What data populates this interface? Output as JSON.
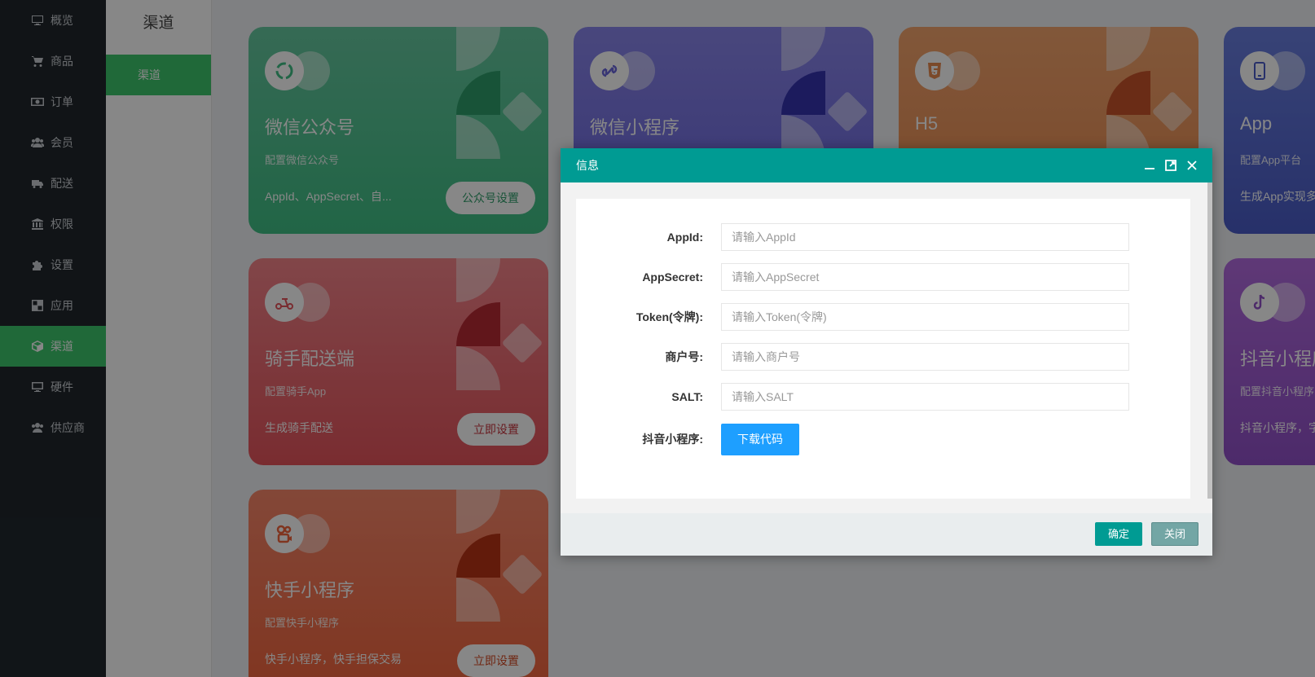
{
  "sidebar": {
    "items": [
      {
        "label": "概览",
        "icon": "monitor-icon"
      },
      {
        "label": "商品",
        "icon": "cart-icon"
      },
      {
        "label": "订单",
        "icon": "money-icon"
      },
      {
        "label": "会员",
        "icon": "users-icon"
      },
      {
        "label": "配送",
        "icon": "truck-icon"
      },
      {
        "label": "权限",
        "icon": "bank-icon"
      },
      {
        "label": "设置",
        "icon": "puzzle-icon"
      },
      {
        "label": "应用",
        "icon": "apps-icon"
      },
      {
        "label": "渠道",
        "icon": "cube-icon",
        "active": true
      },
      {
        "label": "硬件",
        "icon": "desktop-icon"
      },
      {
        "label": "供应商",
        "icon": "supplier-icon"
      }
    ]
  },
  "subbar": {
    "title": "渠道",
    "items": [
      {
        "label": "渠道",
        "active": true
      }
    ]
  },
  "cards": [
    {
      "title": "微信公众号",
      "desc": "配置微信公众号",
      "info": "AppId、AppSecret、自...",
      "button": "公众号设置",
      "icon": "wechat-icon",
      "color": "#3fbf85"
    },
    {
      "title": "微信小程序",
      "desc": "",
      "info": "",
      "button": "",
      "icon": "miniprogram-icon",
      "color": "#6a66dc"
    },
    {
      "title": "H5",
      "desc": "",
      "info": "",
      "button": "",
      "icon": "html5-icon",
      "color": "#e98a4f"
    },
    {
      "title": "App",
      "desc": "配置App平台",
      "info": "生成App实现多",
      "button": "",
      "icon": "phone-icon",
      "color": "#4a5cc8"
    },
    {
      "title": "骑手配送端",
      "desc": "配置骑手App",
      "info": "生成骑手配送",
      "button": "立即设置",
      "icon": "scooter-icon",
      "color": "#e5545c"
    },
    {
      "title": "抖音小程序",
      "desc": "配置抖音小程序",
      "info": "抖音小程序，字",
      "button": "",
      "icon": "tiktok-icon",
      "color": "#9150c9"
    },
    {
      "title": "快手小程序",
      "desc": "配置快手小程序",
      "info": "快手小程序，快手担保交易",
      "button": "立即设置",
      "icon": "kuaishou-icon",
      "color": "#f2643c"
    }
  ],
  "dialog": {
    "title": "信息",
    "fields": [
      {
        "label": "AppId:",
        "placeholder": "请输入AppId",
        "value": ""
      },
      {
        "label": "AppSecret:",
        "placeholder": "请输入AppSecret",
        "value": ""
      },
      {
        "label": "Token(令牌):",
        "placeholder": "请输入Token(令牌)",
        "value": ""
      },
      {
        "label": "商户号:",
        "placeholder": "请输入商户号",
        "value": ""
      },
      {
        "label": "SALT:",
        "placeholder": "请输入SALT",
        "value": ""
      }
    ],
    "download": {
      "label": "抖音小程序:",
      "button": "下载代码"
    },
    "confirm": "确定",
    "close": "关闭"
  }
}
